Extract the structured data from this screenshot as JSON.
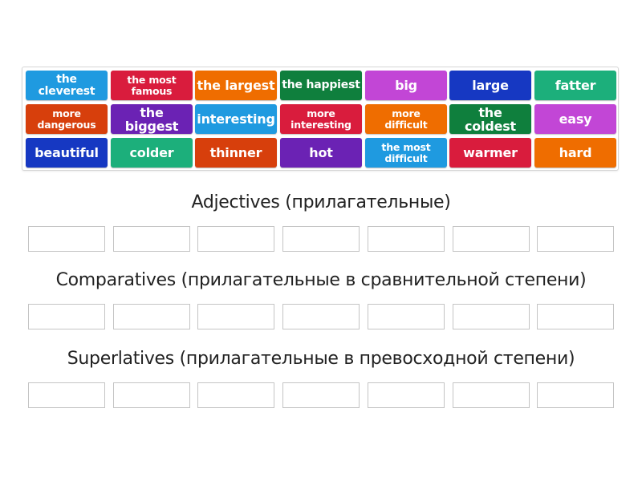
{
  "palette": {
    "blue": "#1f9ae0",
    "red": "#d91c3d",
    "orange": "#ef6d00",
    "green": "#0f7f3d",
    "magenta": "#c246d6",
    "navy": "#1638c2",
    "teal": "#1caf7b",
    "vermilion": "#d73f0c",
    "purple": "#6b22b4"
  },
  "tiles": [
    {
      "text": "the cleverest",
      "color": "blue"
    },
    {
      "text": "the most famous",
      "color": "red"
    },
    {
      "text": "the largest",
      "color": "orange"
    },
    {
      "text": "the happiest",
      "color": "green"
    },
    {
      "text": "big",
      "color": "magenta"
    },
    {
      "text": "large",
      "color": "navy"
    },
    {
      "text": "fatter",
      "color": "teal"
    },
    {
      "text": "more dangerous",
      "color": "vermilion"
    },
    {
      "text": "the biggest",
      "color": "purple"
    },
    {
      "text": "interesting",
      "color": "blue"
    },
    {
      "text": "more interesting",
      "color": "red"
    },
    {
      "text": "more difficult",
      "color": "orange"
    },
    {
      "text": "the coldest",
      "color": "green"
    },
    {
      "text": "easy",
      "color": "magenta"
    },
    {
      "text": "beautiful",
      "color": "navy"
    },
    {
      "text": "colder",
      "color": "teal"
    },
    {
      "text": "thinner",
      "color": "vermilion"
    },
    {
      "text": "hot",
      "color": "purple"
    },
    {
      "text": "the most difficult",
      "color": "blue"
    },
    {
      "text": "warmer",
      "color": "red"
    },
    {
      "text": "hard",
      "color": "orange"
    }
  ],
  "groups": [
    {
      "title": "Adjectives (прилагательные)",
      "slots": 7
    },
    {
      "title": "Comparatives (прилагательные в сравнительной степени)",
      "slots": 7
    },
    {
      "title": "Superlatives (прилагательные в превосходной степени)",
      "slots": 7
    }
  ]
}
